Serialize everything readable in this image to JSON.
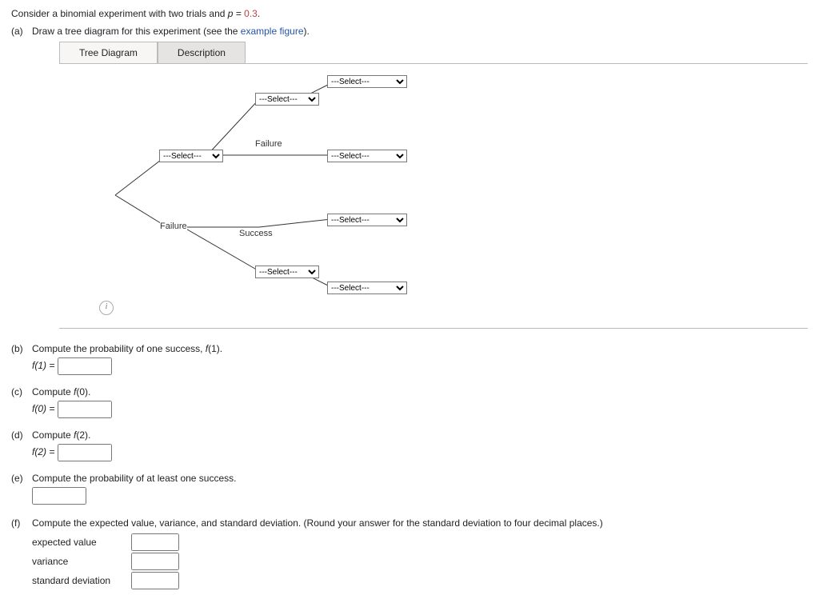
{
  "intro": {
    "prefix": "Consider a binomial experiment with two trials and ",
    "pvar": "p",
    "eq": " = ",
    "pval": "0.3",
    "suffix": "."
  },
  "a": {
    "label": "(a)",
    "text1": "Draw a tree diagram for this experiment (see the ",
    "link": "example figure",
    "text2": ")."
  },
  "tabs": {
    "tree": "Tree Diagram",
    "desc": "Description"
  },
  "tree": {
    "select_placeholder": "---Select---",
    "branch_labels": {
      "top_failure": "Failure",
      "bottom_failure": "Failure",
      "success": "Success"
    },
    "info_tooltip": "i"
  },
  "b": {
    "label": "(b)",
    "text": "Compute the probability of one success, ",
    "fn": "f",
    "arg": "(1).",
    "lhs": "f(1) ="
  },
  "c": {
    "label": "(c)",
    "text": "Compute ",
    "fn": "f",
    "arg": "(0).",
    "lhs": "f(0) ="
  },
  "d": {
    "label": "(d)",
    "text": "Compute ",
    "fn": "f",
    "arg": "(2).",
    "lhs": "f(2) ="
  },
  "e": {
    "label": "(e)",
    "text": "Compute the probability of at least one success."
  },
  "f": {
    "label": "(f)",
    "text": "Compute the expected value, variance, and standard deviation. (Round your answer for the standard deviation to four decimal places.)",
    "rows": {
      "ev": "expected value",
      "var": "variance",
      "sd": "standard deviation"
    }
  }
}
